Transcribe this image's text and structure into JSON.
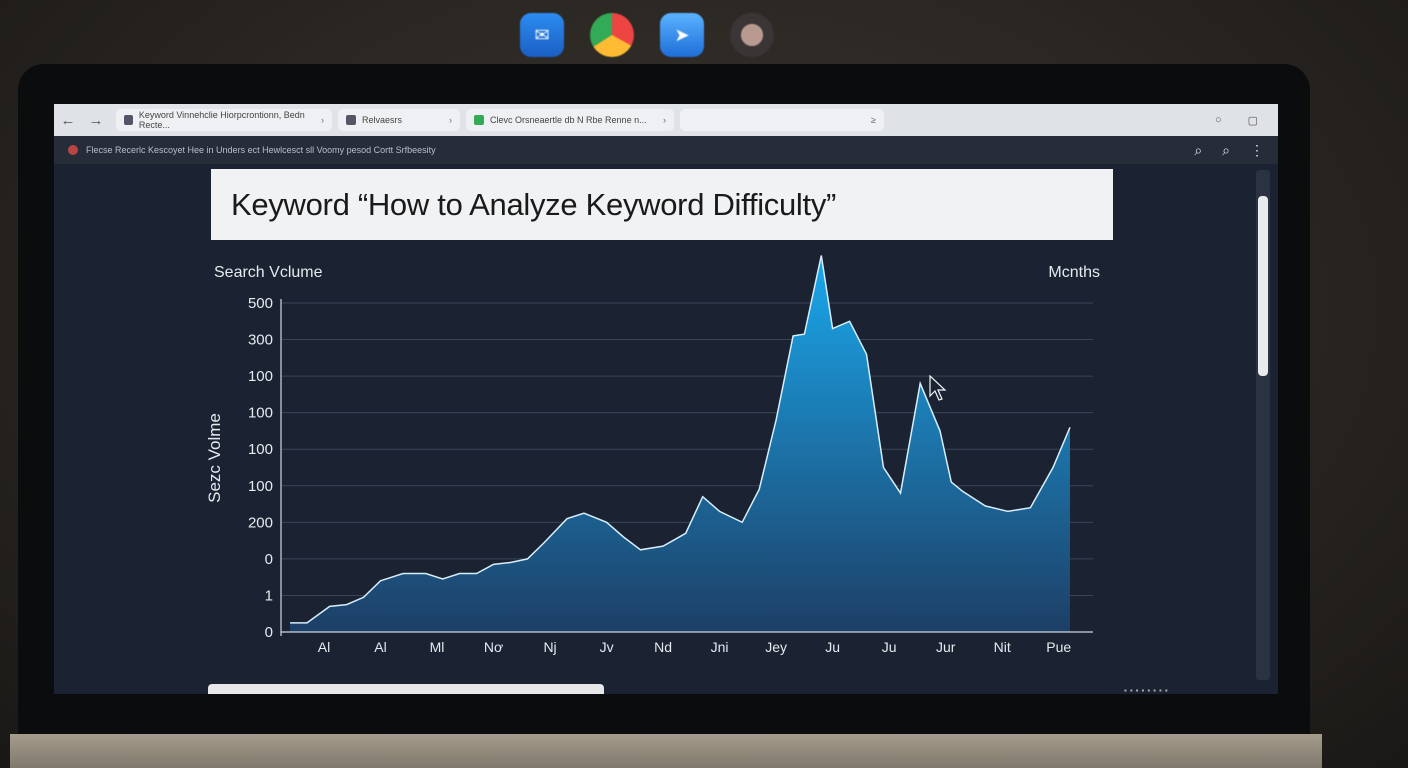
{
  "dock": {
    "apps": [
      "mail-icon",
      "chrome-icon",
      "safari-icon",
      "face-icon"
    ]
  },
  "browser": {
    "tabs": [
      {
        "label": "Keyword Vinnehclie Hiorpcrontionn, Bedn Recte..."
      },
      {
        "label": "Relvaesrs"
      },
      {
        "label": "Clevc Orsneaertle db N Rbe Renne n..."
      }
    ],
    "page_info": "Flecse Recerlc Kescoyet Hee in Unders ect Hewlcesct sll Voomy pesod Cortt Srfbeesity"
  },
  "page": {
    "title": "Keyword “How to Analyze Keyword Difficulty”"
  },
  "chart_data": {
    "type": "area",
    "title": "",
    "top_left_label": "Search Vclume",
    "top_right_label": "Mcnths",
    "ylabel": "Sezc Volme",
    "y_tick_labels": [
      "500",
      "300",
      "100",
      "100",
      "100",
      "100",
      "200",
      "0",
      "1",
      "0"
    ],
    "x_tick_labels": [
      "Al",
      "Al",
      "Ml",
      "Nơ",
      "Nj",
      "Jv",
      "Nd",
      "Jni",
      "Jey",
      "Ju",
      "Ju",
      "Jur",
      "Nit",
      "Pue"
    ],
    "x_index_range": [
      0,
      13.2
    ],
    "y_axis_note": "tick labels are non-monotonic; y values below are in tick positions (0 = bottom tick, 9 = top tick)",
    "ylim": [
      0,
      9
    ],
    "series": [
      {
        "points": [
          [
            -0.6,
            0.25
          ],
          [
            -0.3,
            0.25
          ],
          [
            0.1,
            0.7
          ],
          [
            0.4,
            0.75
          ],
          [
            0.7,
            0.95
          ],
          [
            1.0,
            1.4
          ],
          [
            1.4,
            1.6
          ],
          [
            1.8,
            1.6
          ],
          [
            2.1,
            1.45
          ],
          [
            2.4,
            1.6
          ],
          [
            2.7,
            1.6
          ],
          [
            3.0,
            1.85
          ],
          [
            3.3,
            1.9
          ],
          [
            3.6,
            2.0
          ],
          [
            3.9,
            2.45
          ],
          [
            4.3,
            3.1
          ],
          [
            4.6,
            3.25
          ],
          [
            5.0,
            3.0
          ],
          [
            5.3,
            2.6
          ],
          [
            5.6,
            2.25
          ],
          [
            6.0,
            2.35
          ],
          [
            6.4,
            2.7
          ],
          [
            6.7,
            3.7
          ],
          [
            7.0,
            3.3
          ],
          [
            7.4,
            3.0
          ],
          [
            7.7,
            3.9
          ],
          [
            8.0,
            5.8
          ],
          [
            8.3,
            8.1
          ],
          [
            8.5,
            8.15
          ],
          [
            8.8,
            10.3
          ],
          [
            9.0,
            8.3
          ],
          [
            9.3,
            8.5
          ],
          [
            9.6,
            7.6
          ],
          [
            9.9,
            4.5
          ],
          [
            10.2,
            3.8
          ],
          [
            10.55,
            6.8
          ],
          [
            10.9,
            5.5
          ],
          [
            11.1,
            4.1
          ],
          [
            11.3,
            3.85
          ],
          [
            11.7,
            3.45
          ],
          [
            12.1,
            3.3
          ],
          [
            12.5,
            3.4
          ],
          [
            12.9,
            4.5
          ],
          [
            13.2,
            5.6
          ]
        ]
      }
    ],
    "grid": true,
    "legend": "none",
    "colors": {
      "fill_top": "#1aa8ec",
      "fill_bottom": "#1d3f66",
      "line": "#d6eefc"
    }
  }
}
